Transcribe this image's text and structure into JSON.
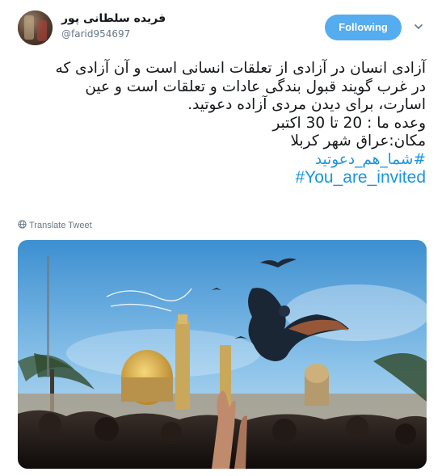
{
  "user": {
    "name": "فریده سلطانی پور",
    "handle": "@farid954697"
  },
  "follow_button": {
    "label": "Following"
  },
  "tweet": {
    "lines": [
      "آزادی انسان در آزادی از تعلقات انسانی است و آن آزادی که",
      "در غرب گویند قبول بندگی عادات و تعلقات است و عین",
      "اسارت،  برای دیدن مردی آزاده دعوتید.",
      "وعده ما : 20 تا 30 اکتبر",
      "مکان:عراق شهر کربلا"
    ],
    "hashtag_fa": "#شما_هم_دعوتید",
    "hashtag_en": "#You_are_invited"
  },
  "translate_label": "Translate Tweet",
  "icons": {
    "caret": "chevron-down-icon",
    "translate": "globe-icon"
  },
  "colors": {
    "follow_bg": "#55acee",
    "link": "#1b95e0",
    "muted": "#657786"
  }
}
